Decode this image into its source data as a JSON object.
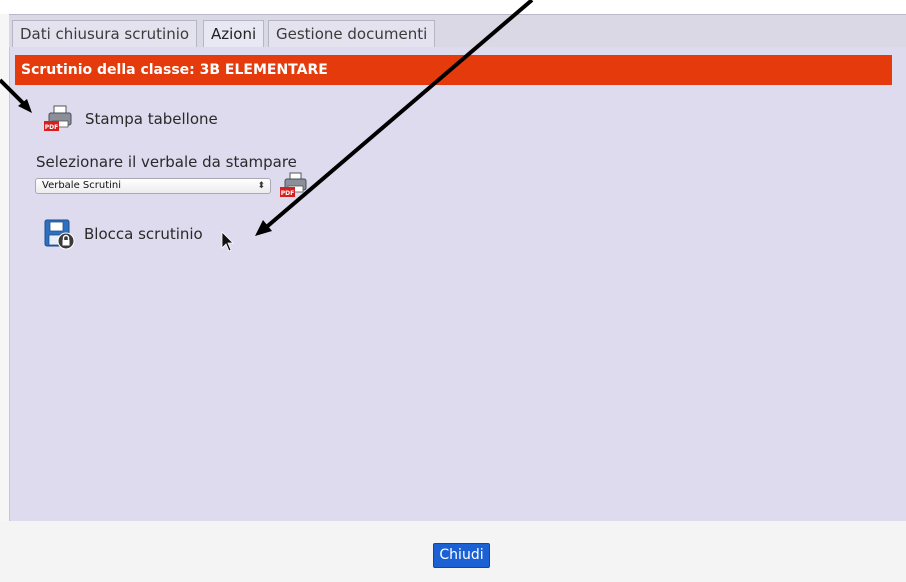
{
  "tabs": [
    {
      "label": "Dati chiusura scrutinio",
      "active": false
    },
    {
      "label": "Azioni",
      "active": true
    },
    {
      "label": "Gestione documenti",
      "active": false
    }
  ],
  "panel": {
    "title": "Scrutinio della classe: 3B ELEMENTARE",
    "print_board": {
      "label": "Stampa tabellone",
      "icon": "pdf-printer-icon"
    },
    "verbale": {
      "label": "Selezionare il verbale da stampare",
      "selected": "Verbale Scrutini",
      "print_icon": "pdf-printer-icon"
    },
    "lock": {
      "label": "Blocca scrutinio",
      "icon": "lock-save-icon"
    }
  },
  "footer": {
    "close_label": "Chiudi"
  },
  "colors": {
    "title_bar": "#e53b0c",
    "panel_bg": "#dddbed",
    "button": "#1c61d4"
  }
}
